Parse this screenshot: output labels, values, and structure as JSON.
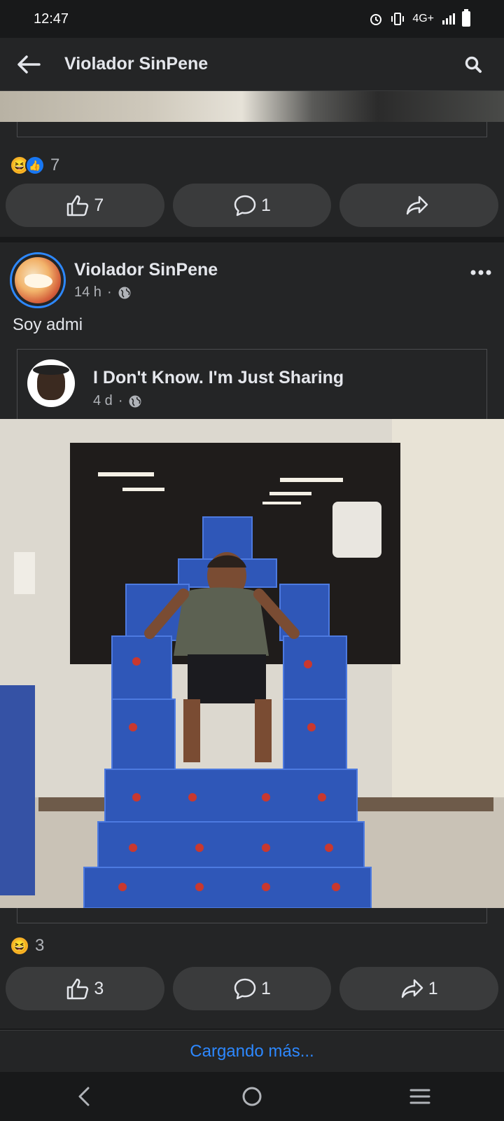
{
  "status_bar": {
    "time": "12:47",
    "network": "4G+",
    "icons": [
      "alarm-icon",
      "vibrate-icon",
      "signal-icon",
      "battery-icon"
    ]
  },
  "header": {
    "back_icon": "back-arrow-icon",
    "title": "Violador SinPene",
    "search_icon": "search-icon"
  },
  "posts": [
    {
      "reactions": {
        "types": [
          "haha",
          "like"
        ],
        "count": "7"
      },
      "actions": {
        "like_count": "7",
        "comment_count": "1",
        "share_count": ""
      }
    },
    {
      "author": "Violador SinPene",
      "time": "14 h",
      "privacy_icon": "globe-icon",
      "text": "Soy admi",
      "shared": {
        "author": "I Don't Know. I'm Just Sharing",
        "time": "4 d",
        "privacy_icon": "globe-icon"
      },
      "reactions": {
        "types": [
          "haha"
        ],
        "count": "3"
      },
      "actions": {
        "like_count": "3",
        "comment_count": "1",
        "share_count": "1"
      }
    }
  ],
  "loading_text": "Cargando más...",
  "nav": [
    "back-nav-icon",
    "home-nav-icon",
    "recents-nav-icon"
  ],
  "colors": {
    "background": "#18191a",
    "surface": "#242526",
    "button": "#3a3b3c",
    "accent": "#2d88ff",
    "text": "#e4e6eb",
    "secondary_text": "#b0b3b8"
  }
}
